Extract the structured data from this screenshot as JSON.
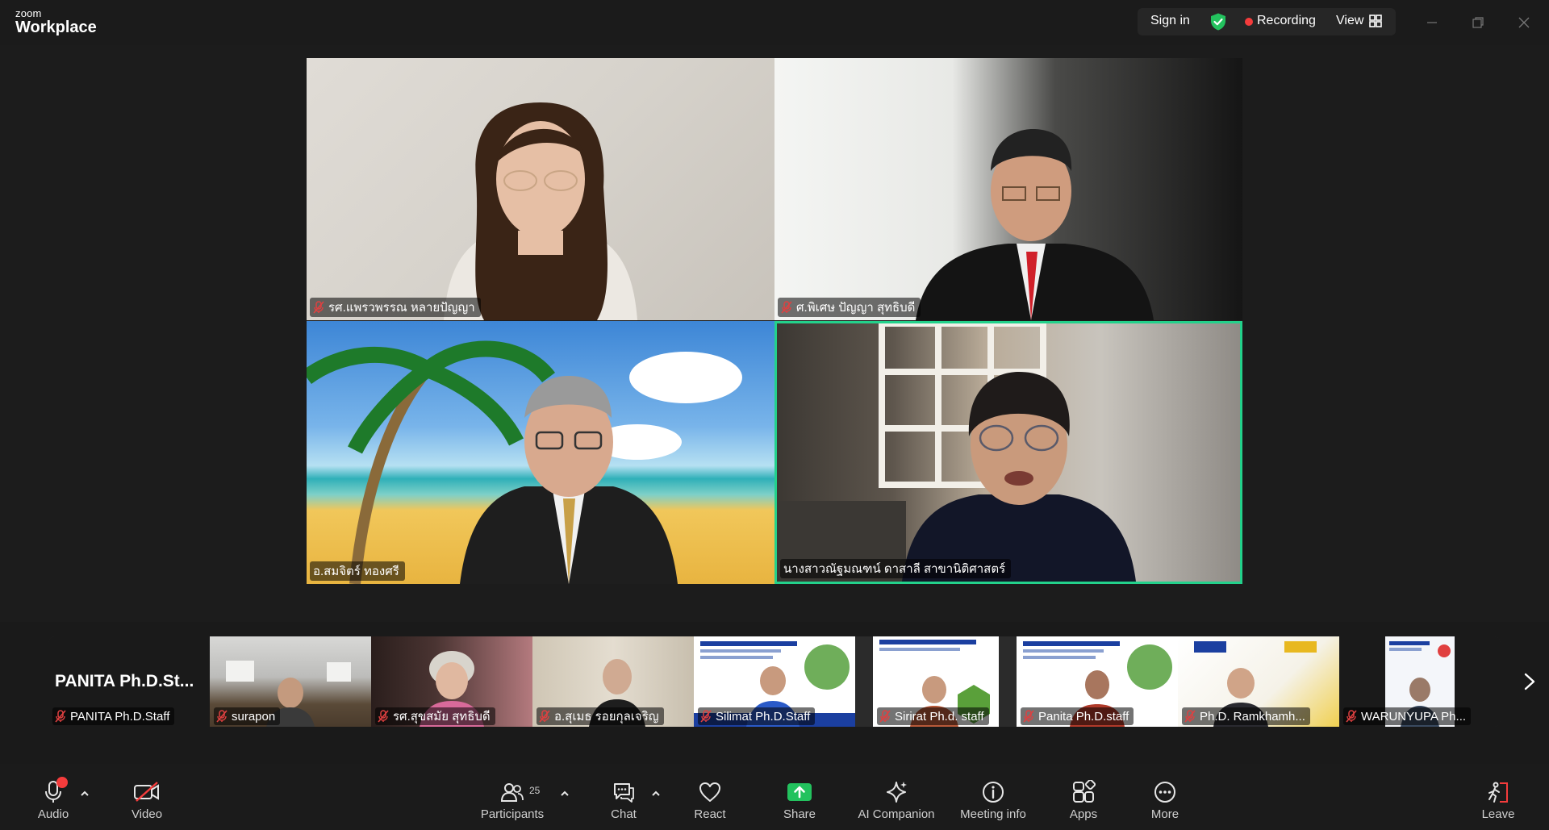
{
  "app": {
    "logo_small": "zoom",
    "logo_big": "Workplace"
  },
  "topbar": {
    "signin_label": "Sign in",
    "shield_icon": "shield-check-icon",
    "recording_label": "Recording",
    "view_label": "View",
    "colors": {
      "shield": "#23c25e",
      "recording_dot": "#f53c3c"
    }
  },
  "gallery": [
    {
      "name": "รศ.แพรวพรรณ หลายปัญญา",
      "muted": true,
      "active": false
    },
    {
      "name": "ศ.พิเศษ ปัญญา สุทธิบดี",
      "muted": true,
      "active": false
    },
    {
      "name": "อ.สมจิตร์ ทองศรี",
      "muted": false,
      "active": false
    },
    {
      "name": "นางสาวณัฐมณฑน์ ดาสาลี สาขานิติศาสตร์",
      "muted": false,
      "active": true
    }
  ],
  "strip": [
    {
      "name": "PANITA Ph.D.Staff",
      "avatar_text": "PANITA  Ph.D.St...",
      "muted": true
    },
    {
      "name": "surapon",
      "muted": true
    },
    {
      "name": "รศ.สุขสมัย สุทธิบดี",
      "muted": true
    },
    {
      "name": "อ.สุเมธ รอยกุลเจริญ",
      "muted": true
    },
    {
      "name": "Silimat Ph.D.Staff",
      "muted": true
    },
    {
      "name": "Sirirat Ph.d. staff",
      "muted": true
    },
    {
      "name": "Panita Ph.D.staff",
      "muted": true
    },
    {
      "name": "Ph.D. Ramkhamh...",
      "muted": true
    },
    {
      "name": "WARUNYUPA Ph...",
      "muted": true
    }
  ],
  "controls": {
    "audio_label": "Audio",
    "video_label": "Video",
    "participants_label": "Participants",
    "participants_count": "25",
    "chat_label": "Chat",
    "react_label": "React",
    "share_label": "Share",
    "ai_label": "AI Companion",
    "info_label": "Meeting info",
    "apps_label": "Apps",
    "more_label": "More",
    "leave_label": "Leave",
    "colors": {
      "share": "#23c25e",
      "leave": "#f53c3c",
      "audio_dot": "#f53c3c"
    }
  }
}
